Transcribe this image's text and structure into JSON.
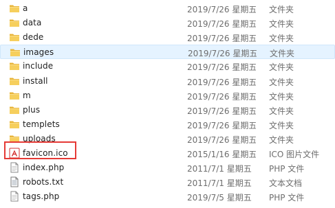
{
  "files": [
    {
      "name": "a",
      "date": "2019/7/26 星期五",
      "type": "文件夹",
      "icon": "folder-icon"
    },
    {
      "name": "data",
      "date": "2019/7/26 星期五",
      "type": "文件夹",
      "icon": "folder-icon"
    },
    {
      "name": "dede",
      "date": "2019/7/26 星期五",
      "type": "文件夹",
      "icon": "folder-icon"
    },
    {
      "name": "images",
      "date": "2019/7/26 星期五",
      "type": "文件夹",
      "icon": "folder-icon",
      "selected": true
    },
    {
      "name": "include",
      "date": "2019/7/26 星期五",
      "type": "文件夹",
      "icon": "folder-icon"
    },
    {
      "name": "install",
      "date": "2019/7/26 星期五",
      "type": "文件夹",
      "icon": "folder-icon"
    },
    {
      "name": "m",
      "date": "2019/7/26 星期五",
      "type": "文件夹",
      "icon": "folder-icon"
    },
    {
      "name": "plus",
      "date": "2019/7/26 星期五",
      "type": "文件夹",
      "icon": "folder-icon"
    },
    {
      "name": "templets",
      "date": "2019/7/26 星期五",
      "type": "文件夹",
      "icon": "folder-icon"
    },
    {
      "name": "uploads",
      "date": "2019/7/26 星期五",
      "type": "文件夹",
      "icon": "folder-icon"
    },
    {
      "name": "favicon.ico",
      "date": "2015/1/16 星期五",
      "type": "ICO 图片文件",
      "icon": "acrobat-ico-icon",
      "highlighted": true
    },
    {
      "name": "index.php",
      "date": "2011/7/1 星期五",
      "type": "PHP 文件",
      "icon": "php-file-icon"
    },
    {
      "name": "robots.txt",
      "date": "2011/7/1 星期五",
      "type": "文本文档",
      "icon": "text-file-icon"
    },
    {
      "name": "tags.php",
      "date": "2019/7/5 星期五",
      "type": "PHP 文件",
      "icon": "php-file-icon"
    }
  ],
  "colors": {
    "folder": "#f3c64e",
    "selection": "#e5f3ff",
    "highlight_border": "#e53935",
    "ico_red": "#d32f2f"
  }
}
